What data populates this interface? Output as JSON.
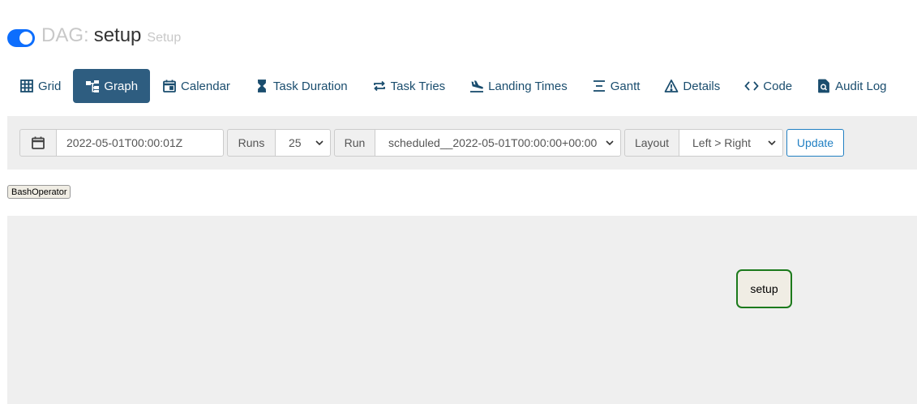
{
  "header": {
    "toggle_on": true,
    "dag_prefix": "DAG:",
    "dag_id": "setup",
    "dag_description": "Setup"
  },
  "tabs": [
    {
      "label": "Grid",
      "icon": "grid-icon",
      "active": false
    },
    {
      "label": "Graph",
      "icon": "graph-icon",
      "active": true
    },
    {
      "label": "Calendar",
      "icon": "calendar-icon",
      "active": false
    },
    {
      "label": "Task Duration",
      "icon": "hourglass-icon",
      "active": false
    },
    {
      "label": "Task Tries",
      "icon": "retry-icon",
      "active": false
    },
    {
      "label": "Landing Times",
      "icon": "plane-landing-icon",
      "active": false
    },
    {
      "label": "Gantt",
      "icon": "gantt-icon",
      "active": false
    },
    {
      "label": "Details",
      "icon": "warning-icon",
      "active": false
    },
    {
      "label": "Code",
      "icon": "code-icon",
      "active": false
    },
    {
      "label": "Audit Log",
      "icon": "audit-log-icon",
      "active": false
    }
  ],
  "toolbar": {
    "base_date": "2022-05-01T00:00:01Z",
    "runs_label": "Runs",
    "runs_value": "25",
    "run_label": "Run",
    "run_value": "scheduled__2022-05-01T00:00:00+00:00",
    "layout_label": "Layout",
    "layout_value": "Left > Right",
    "update_label": "Update"
  },
  "legend": {
    "operator": "BashOperator"
  },
  "graph": {
    "nodes": [
      {
        "label": "setup",
        "operator": "BashOperator",
        "state_color": "#1c7a1c"
      }
    ]
  },
  "colors": {
    "accent": "#2e5d80",
    "toggle": "#0d6efd",
    "update_button": "#2280c3",
    "node_border": "#1c7a1c",
    "node_fill": "#f0ede4"
  }
}
